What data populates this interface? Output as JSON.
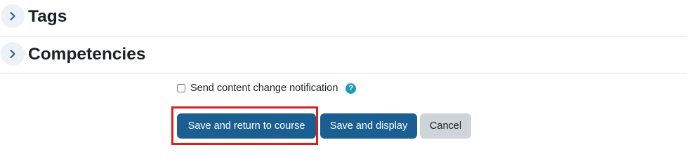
{
  "sections": {
    "tags": {
      "title": "Tags",
      "icon": "chevron-right-icon"
    },
    "competencies": {
      "title": "Competencies",
      "icon": "chevron-right-icon"
    }
  },
  "notification": {
    "label": "Send content change notification",
    "checked": false,
    "help_icon": "question-circle-icon",
    "help_glyph": "?"
  },
  "buttons": {
    "save_return": "Save and return to course",
    "save_display": "Save and display",
    "cancel": "Cancel"
  },
  "colors": {
    "primary": "#1b5f92",
    "secondary": "#ced4da",
    "help": "#1f9bb5",
    "highlight": "#d9201a"
  }
}
